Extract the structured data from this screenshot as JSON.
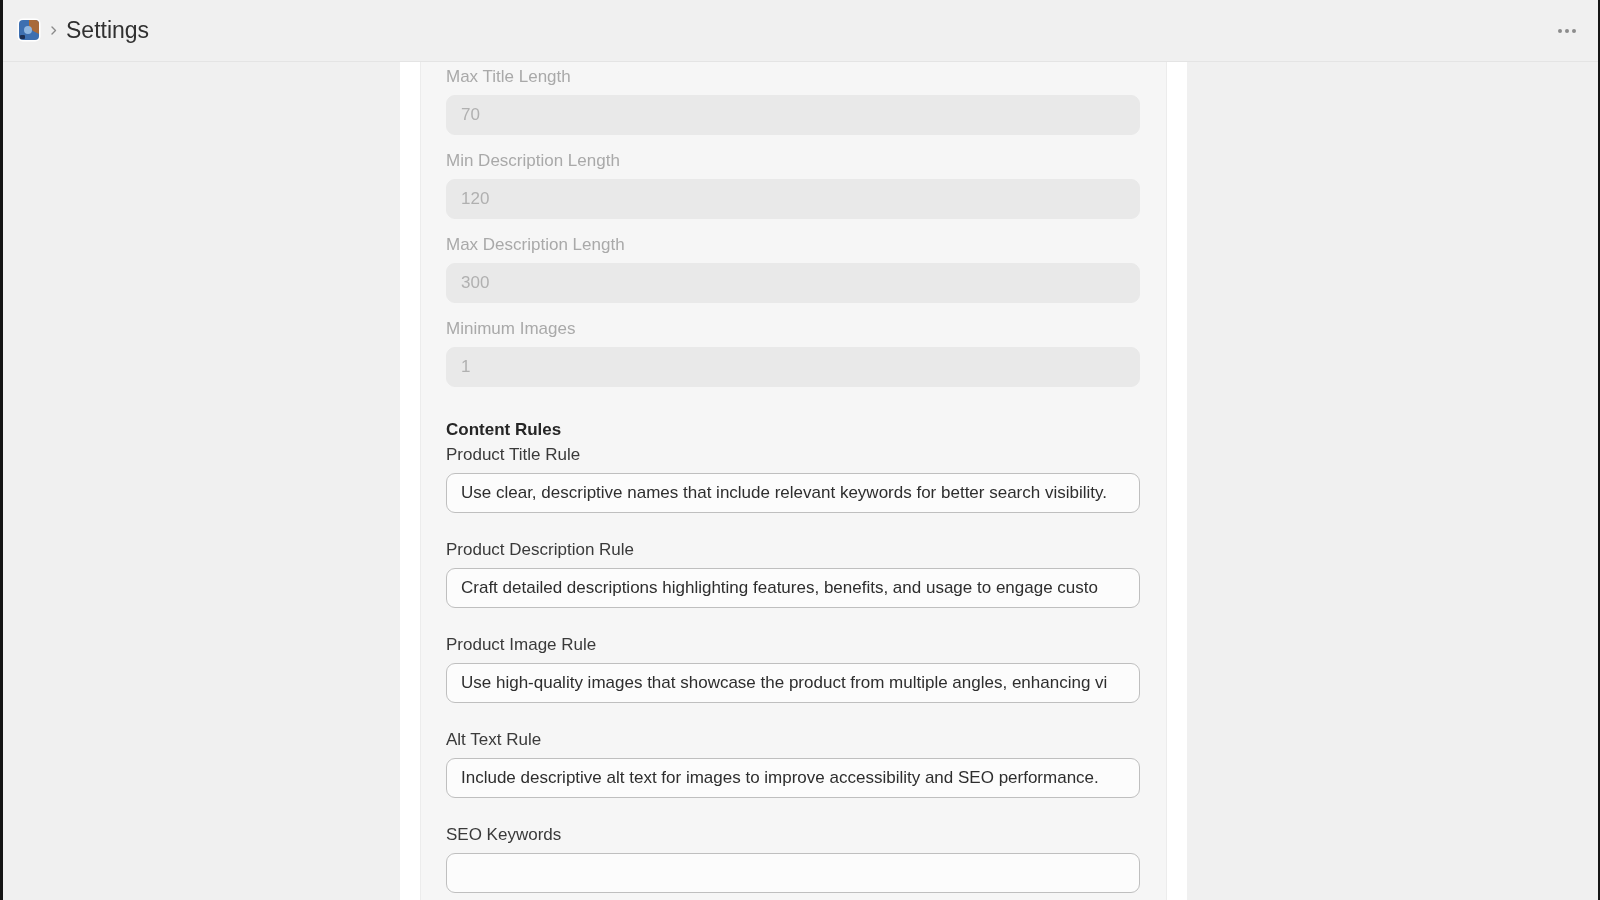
{
  "header": {
    "title": "Settings"
  },
  "form": {
    "limit_fields": [
      {
        "label": "Max Title Length",
        "value": "70",
        "disabled": true
      },
      {
        "label": "Min Description Length",
        "value": "120",
        "disabled": true
      },
      {
        "label": "Max Description Length",
        "value": "300",
        "disabled": true
      },
      {
        "label": "Minimum Images",
        "value": "1",
        "disabled": true
      }
    ],
    "content_rules": {
      "heading": "Content Rules",
      "fields": [
        {
          "label": "Product Title Rule",
          "value": "Use clear, descriptive names that include relevant keywords for better search visibility.",
          "disabled": false
        },
        {
          "label": "Product Description Rule",
          "value": "Craft detailed descriptions highlighting features, benefits, and usage to engage custo",
          "disabled": false
        },
        {
          "label": "Product Image Rule",
          "value": "Use high-quality images that showcase the product from multiple angles, enhancing vi",
          "disabled": false
        },
        {
          "label": "Alt Text Rule",
          "value": "Include descriptive alt text for images to improve accessibility and SEO performance.",
          "disabled": false
        },
        {
          "label": "SEO Keywords",
          "disabled": false
        }
      ]
    }
  }
}
